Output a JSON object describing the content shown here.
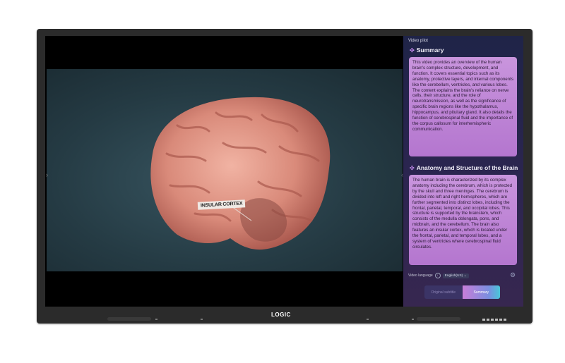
{
  "brand": {
    "logo": "LOGIC"
  },
  "video": {
    "label_text": "INSULAR CORTEX"
  },
  "panel": {
    "title": "Video pilot",
    "sections": [
      {
        "heading": "Summary",
        "body": "This video provides an overview of the human brain's complex structure, development, and function. It covers essential topics such as its anatomy, protective layers, and internal components like the cerebellum, ventricles, and various lobes. The content explains the brain's reliance on nerve cells, their structure, and the role of neurotransmission, as well as the significance of specific brain regions like the hypothalamus, hippocampus, and pituitary gland. It also details the function of cerebrospinal fluid and the importance of the corpus callosum for interhemispheric communication."
      },
      {
        "heading": "Anatomy and Structure of the Brain",
        "body": "The human brain is characterized by its complex anatomy including the cerebrum, which is protected by the skull and three meninges. The cerebrum is divided into left and right hemispheres, which are further segmented into distinct lobes, including the frontal, parietal, temporal, and occipital lobes. This structure is supported by the brainstem, which consists of the medulla oblongata, pons, and midbrain, and the cerebellum. The brain also features an insular cortex, which is located under the frontal, parietal, and temporal lobes, and a system of ventricles where cerebrospinal fluid circulates."
      }
    ],
    "language_label": "Video language",
    "language_value": "English(US)",
    "tabs": {
      "original": "Original subtitle",
      "summary": "Summary"
    }
  },
  "colors": {
    "accent": "#c58cf0",
    "card": "#c995dd",
    "panel": "#1f2448"
  }
}
